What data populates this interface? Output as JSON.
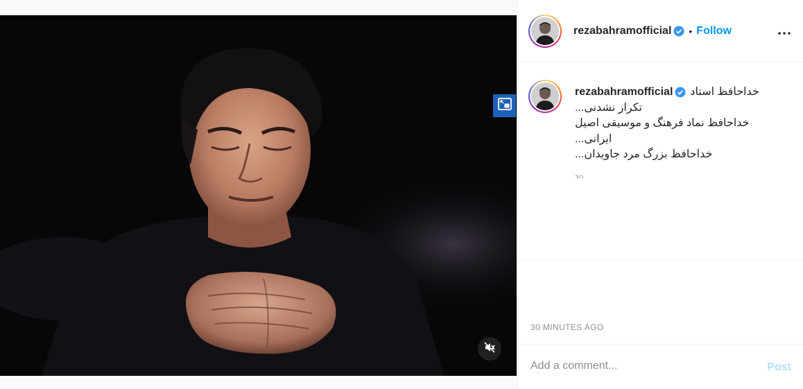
{
  "post": {
    "media_description_icon": "portrait-photo",
    "pip_icon": "picture-in-picture-icon",
    "mute_icon": "speaker-muted-icon"
  },
  "header": {
    "username": "rezabahramofficial",
    "dot": "•",
    "follow_label": "Follow",
    "more_icon": "more-horizontal-icon"
  },
  "caption": {
    "username": "rezabahramofficial",
    "lines": [
      "خداحافظ استاد",
      "تکرار نشدنی...",
      "خداحافظ نماد فرهنگ و موسیقی اصیل",
      "ایرانی...",
      "خداحافظ بزرگ مرد جاویدان..."
    ],
    "partial_time": "30"
  },
  "timestamp": "30 MINUTES AGO",
  "comment": {
    "placeholder": "Add a comment...",
    "post_label": "Post"
  },
  "colors": {
    "accent": "#0095f6",
    "post_disabled": "#b2dffc",
    "verified": "#3897f0",
    "pip_button": "#1f63b8"
  }
}
